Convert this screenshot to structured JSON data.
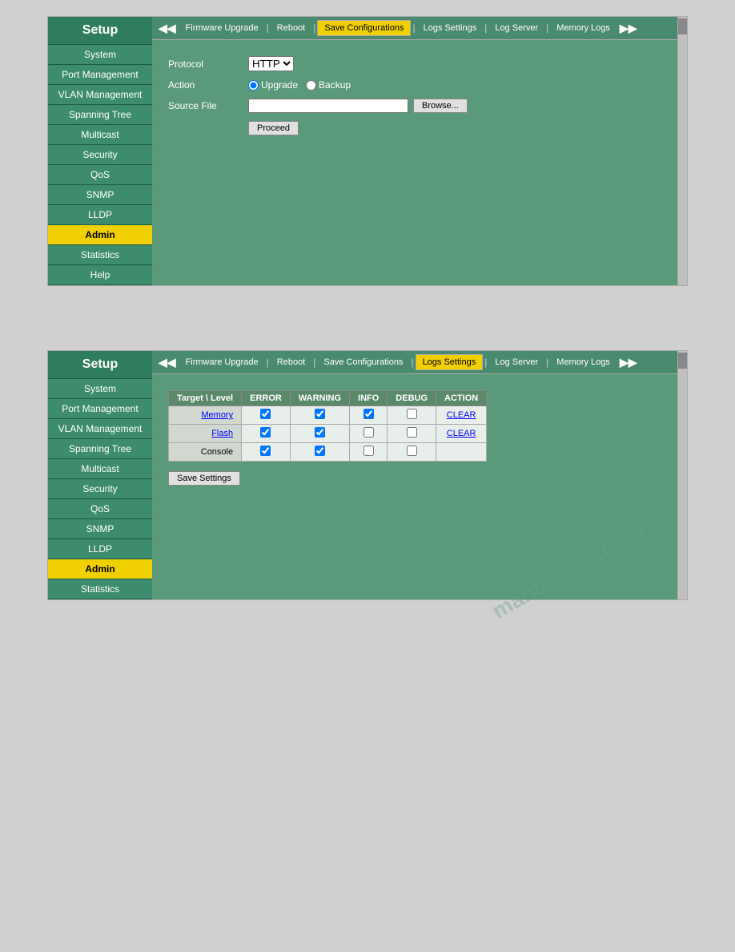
{
  "panels": [
    {
      "id": "panel1",
      "sidebar": {
        "title": "Setup",
        "items": [
          {
            "label": "System",
            "active": false
          },
          {
            "label": "Port Management",
            "active": false
          },
          {
            "label": "VLAN Management",
            "active": false
          },
          {
            "label": "Spanning Tree",
            "active": false
          },
          {
            "label": "Multicast",
            "active": false
          },
          {
            "label": "Security",
            "active": false
          },
          {
            "label": "QoS",
            "active": false
          },
          {
            "label": "SNMP",
            "active": false
          },
          {
            "label": "LLDP",
            "active": false
          },
          {
            "label": "Admin",
            "active": true
          },
          {
            "label": "Statistics",
            "active": false
          },
          {
            "label": "Help",
            "active": false
          }
        ]
      },
      "tabs": {
        "items": [
          {
            "label": "Firmware Upgrade",
            "active": false
          },
          {
            "label": "Reboot",
            "active": false
          },
          {
            "label": "Save Configurations",
            "active": true
          },
          {
            "label": "Logs Settings",
            "active": false
          },
          {
            "label": "Log Server",
            "active": false
          },
          {
            "label": "Memory Logs",
            "active": false
          }
        ]
      },
      "content": {
        "type": "firmware_upgrade",
        "protocol_label": "Protocol",
        "protocol_value": "HTTP",
        "action_label": "Action",
        "action_upgrade": "Upgrade",
        "action_backup": "Backup",
        "source_file_label": "Source File",
        "source_file_placeholder": "",
        "browse_label": "Browse...",
        "proceed_label": "Proceed"
      }
    },
    {
      "id": "panel2",
      "sidebar": {
        "title": "Setup",
        "items": [
          {
            "label": "System",
            "active": false
          },
          {
            "label": "Port Management",
            "active": false
          },
          {
            "label": "VLAN Management",
            "active": false
          },
          {
            "label": "Spanning Tree",
            "active": false
          },
          {
            "label": "Multicast",
            "active": false
          },
          {
            "label": "Security",
            "active": false
          },
          {
            "label": "QoS",
            "active": false
          },
          {
            "label": "SNMP",
            "active": false
          },
          {
            "label": "LLDP",
            "active": false
          },
          {
            "label": "Admin",
            "active": true
          },
          {
            "label": "Statistics",
            "active": false
          }
        ]
      },
      "tabs": {
        "items": [
          {
            "label": "Firmware Upgrade",
            "active": false
          },
          {
            "label": "Reboot",
            "active": false
          },
          {
            "label": "Save Configurations",
            "active": false
          },
          {
            "label": "Logs Settings",
            "active": true
          },
          {
            "label": "Log Server",
            "active": false
          },
          {
            "label": "Memory Logs",
            "active": false
          }
        ]
      },
      "content": {
        "type": "logs_settings",
        "table": {
          "headers": [
            "Target \\ Level",
            "ERROR",
            "WARNING",
            "INFO",
            "DEBUG",
            "ACTION"
          ],
          "rows": [
            {
              "target": "Memory",
              "target_link": true,
              "error": true,
              "warning": true,
              "info": true,
              "debug": false,
              "action": "CLEAR"
            },
            {
              "target": "Flash",
              "target_link": true,
              "error": true,
              "warning": true,
              "info": false,
              "debug": false,
              "action": "CLEAR"
            },
            {
              "target": "Console",
              "target_link": false,
              "error": true,
              "warning": true,
              "info": false,
              "debug": false,
              "action": ""
            }
          ]
        },
        "save_settings_label": "Save Settings"
      }
    }
  ],
  "watermark": "manualsho.com"
}
